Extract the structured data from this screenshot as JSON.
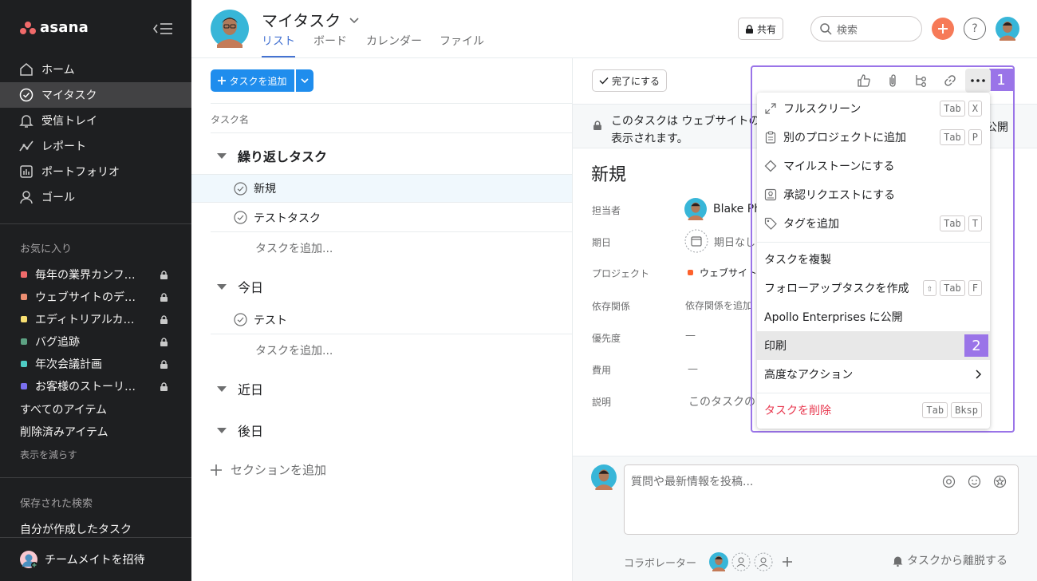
{
  "sidebar": {
    "logo": "asana",
    "nav": [
      "ホーム",
      "マイタスク",
      "受信トレイ",
      "レポート",
      "ポートフォリオ",
      "ゴール"
    ],
    "favorites_title": "お気に入り",
    "favorites": [
      {
        "label": "毎年の業界カンフ…",
        "color": "#f06a6a"
      },
      {
        "label": "ウェブサイトのデ…",
        "color": "#ec8d71"
      },
      {
        "label": "エディトリアルカ…",
        "color": "#f8df72"
      },
      {
        "label": "バグ追跡",
        "color": "#5da283"
      },
      {
        "label": "年次会議計画",
        "color": "#4ecbc4"
      },
      {
        "label": "お客様のストーリ…",
        "color": "#7a6ff0"
      }
    ],
    "all_items": "すべてのアイテム",
    "deleted_items": "削除済みアイテム",
    "show_less": "表示を減らす",
    "saved_search_title": "保存された検索",
    "saved_search_item": "自分が作成したタスク",
    "invite": "チームメイトを招待"
  },
  "header": {
    "title": "マイタスク",
    "tabs": [
      "リスト",
      "ボード",
      "カレンダー",
      "ファイル"
    ],
    "share": "共有",
    "search_placeholder": "検索",
    "help": "?"
  },
  "list": {
    "add_task": "タスクを追加",
    "column_header": "タスク名",
    "sections": [
      "繰り返しタスク",
      "今日",
      "近日",
      "後日"
    ],
    "tasks": [
      "新規",
      "テストタスク",
      "テスト"
    ],
    "add_task_row": "タスクを追加...",
    "add_section": "セクションを追加"
  },
  "detail": {
    "complete": "完了にする",
    "banner_text": "このタスクは ウェブサイトの 表示されます。",
    "banner_right": "公開",
    "task_name": "新規",
    "fields": {
      "assignee_label": "担当者",
      "assignee_value": "Blake Ph",
      "due_label": "期日",
      "due_value": "期日なし",
      "project_label": "プロジェクト",
      "project_value": "ウェブサイトの",
      "dependency_label": "依存関係",
      "dependency_value": "依存関係を追加",
      "priority_label": "優先度",
      "priority_value": "—",
      "cost_label": "費用",
      "cost_value": "—",
      "description_label": "説明",
      "description_value": "このタスクの"
    },
    "comment_placeholder": "質問や最新情報を投稿...",
    "collaborators_label": "コラボレーター",
    "leave_task": "タスクから離脱する"
  },
  "menu": {
    "items": [
      {
        "label": "フルスクリーン",
        "keys": [
          "Tab",
          "X"
        ]
      },
      {
        "label": "別のプロジェクトに追加",
        "keys": [
          "Tab",
          "P"
        ]
      },
      {
        "label": "マイルストーンにする"
      },
      {
        "label": "承認リクエストにする"
      },
      {
        "label": "タグを追加",
        "keys": [
          "Tab",
          "T"
        ]
      },
      {
        "label": "タスクを複製"
      },
      {
        "label": "フォローアップタスクを作成",
        "keys": [
          "⇧",
          "Tab",
          "F"
        ]
      },
      {
        "label": "Apollo Enterprises に公開"
      },
      {
        "label": "印刷"
      },
      {
        "label": "高度なアクション"
      },
      {
        "label": "タスクを削除",
        "keys": [
          "Tab",
          "Bksp"
        ]
      }
    ]
  },
  "annotations": [
    "1",
    "2"
  ],
  "colors": {
    "accent": "#4573d2",
    "primary_button": "#1f8ded",
    "highlight": "#9a74e8",
    "danger": "#e8384f"
  }
}
